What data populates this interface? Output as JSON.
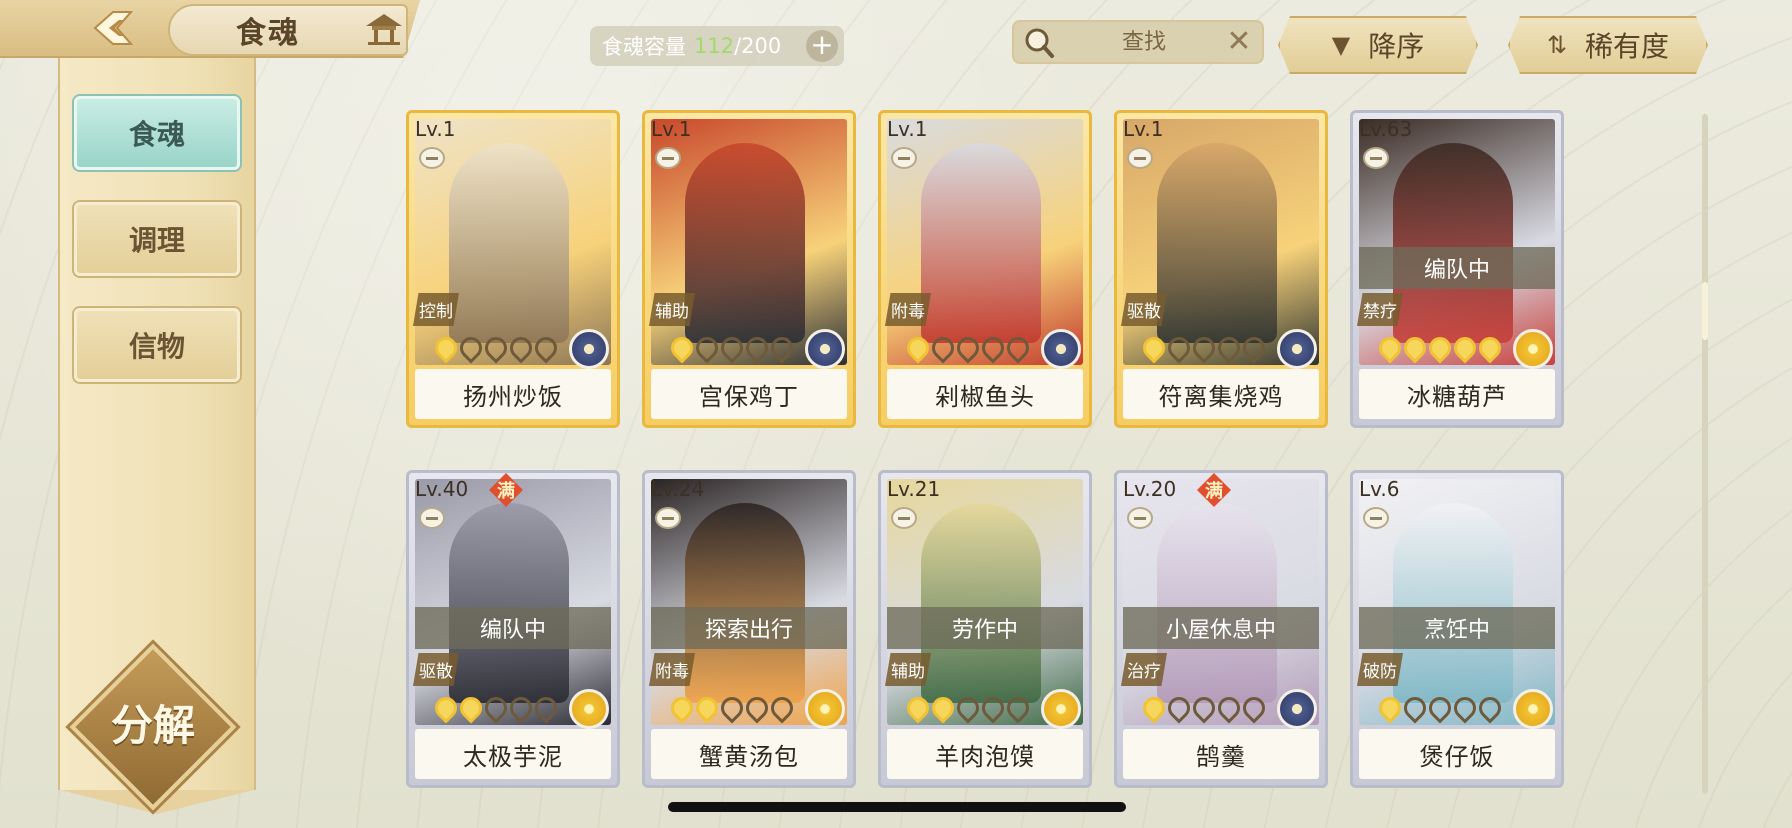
{
  "header": {
    "title": "食魂",
    "capacity_label": "食魂容量",
    "capacity_current": "112",
    "capacity_max": "/200",
    "capacity_plus": "+",
    "search_placeholder": "查找",
    "search_clear": "✕",
    "sort_order_label": "降序",
    "sort_order_icon": "triangle-down-icon",
    "sort_by_label": "稀有度",
    "sort_by_icon": "swap-icon"
  },
  "sidebar": {
    "items": [
      {
        "label": "食魂",
        "active": true
      },
      {
        "label": "调理",
        "active": false
      },
      {
        "label": "信物",
        "active": false
      }
    ],
    "decompose_label": "分解"
  },
  "cards": [
    {
      "level": "Lv.1",
      "name": "扬州炒饭",
      "role": "控制",
      "rarity": "gold",
      "stars": 1,
      "element": "blue",
      "status": "",
      "full": false,
      "palette": [
        "#efe3c8",
        "#8e7656"
      ]
    },
    {
      "level": "Lv.1",
      "name": "宫保鸡丁",
      "role": "辅助",
      "rarity": "gold",
      "stars": 1,
      "element": "blue",
      "status": "",
      "full": false,
      "palette": [
        "#c8482c",
        "#2b2f36"
      ]
    },
    {
      "level": "Lv.1",
      "name": "剁椒鱼头",
      "role": "附毒",
      "rarity": "gold",
      "stars": 1,
      "element": "blue",
      "status": "",
      "full": false,
      "palette": [
        "#d9dbe0",
        "#c23a2e"
      ]
    },
    {
      "level": "Lv.1",
      "name": "符离集烧鸡",
      "role": "驱散",
      "rarity": "gold",
      "stars": 1,
      "element": "blue",
      "status": "",
      "full": false,
      "palette": [
        "#d7a769",
        "#2f3430"
      ]
    },
    {
      "level": "Lv.63",
      "name": "冰糖葫芦",
      "role": "禁疗",
      "rarity": "silver",
      "stars": 5,
      "element": "gold",
      "status": "编队中",
      "full": false,
      "palette": [
        "#3b2b24",
        "#c8403b"
      ]
    },
    {
      "level": "Lv.40",
      "name": "太极芋泥",
      "role": "驱散",
      "rarity": "silver",
      "stars": 2,
      "element": "gold",
      "status": "编队中",
      "full": true,
      "full_label": "满",
      "palette": [
        "#9a9aa8",
        "#2a2a33"
      ]
    },
    {
      "level": "Lv.24",
      "name": "蟹黄汤包",
      "role": "附毒",
      "rarity": "silver",
      "stars": 2,
      "element": "gold",
      "status": "探索出行",
      "full": false,
      "palette": [
        "#2b2424",
        "#f0a34a"
      ]
    },
    {
      "level": "Lv.21",
      "name": "羊肉泡馍",
      "role": "辅助",
      "rarity": "silver",
      "stars": 2,
      "element": "gold",
      "status": "劳作中",
      "full": false,
      "palette": [
        "#e6d89c",
        "#3f6a45"
      ]
    },
    {
      "level": "Lv.20",
      "name": "鹄羹",
      "role": "治疗",
      "rarity": "silver",
      "stars": 1,
      "element": "blue",
      "status": "小屋休息中",
      "full": true,
      "full_label": "满",
      "palette": [
        "#e7e4ee",
        "#b39ab8"
      ]
    },
    {
      "level": "Lv.6",
      "name": "煲仔饭",
      "role": "破防",
      "rarity": "silver",
      "stars": 1,
      "element": "gold",
      "status": "烹饪中",
      "full": false,
      "palette": [
        "#f2f2f4",
        "#7fb7c6"
      ]
    }
  ],
  "scroll": {
    "position_fraction": 0.27
  }
}
